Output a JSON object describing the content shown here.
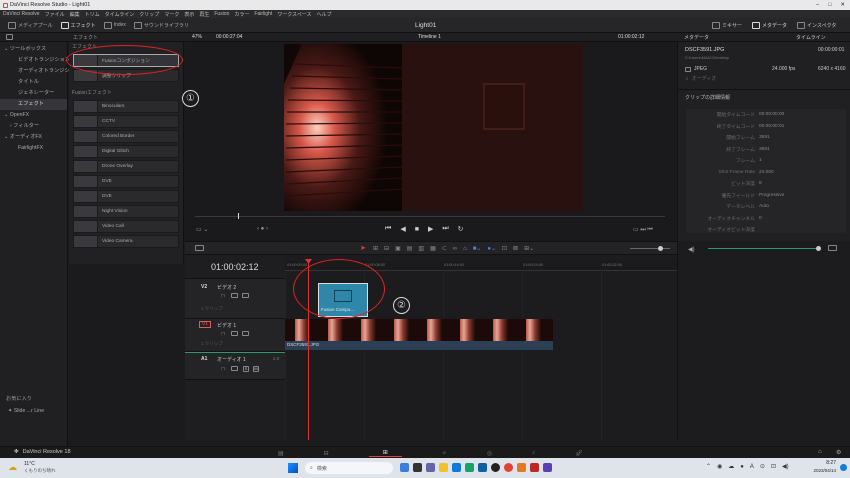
{
  "window": {
    "title": "DaVinci Resolve Studio - Light01"
  },
  "menu": [
    "DaVinci Resolve",
    "ファイル",
    "編集",
    "トリム",
    "タイムライン",
    "クリップ",
    "マーク",
    "表示",
    "再生",
    "Fusion",
    "カラー",
    "Fairlight",
    "ワークスペース",
    "ヘルプ"
  ],
  "toolbar": {
    "media_pool": "メディアプール",
    "effects": "エフェクト",
    "index": "Index",
    "sound_library": "サウンドライブラリ",
    "project_title": "Light01",
    "mixer": "ミキサー",
    "metadata": "メタデータ",
    "inspector": "インスペクタ"
  },
  "subbar": {
    "effects_header": "エフェクト",
    "zoom": "47%",
    "source_tc": "00:00:27:04",
    "timeline_name": "Timeline 1",
    "record_tc": "01:00:02:12",
    "metadata_header": "メタデータ",
    "timeline_header": "タイムライン"
  },
  "tree": {
    "items": [
      "ツールボックス",
      "ビデオトランジション",
      "オーディオトランジション",
      "タイトル",
      "ジェネレーター",
      "エフェクト",
      "OpenFX",
      "フィルター",
      "オーディオFX",
      "FairlightFX"
    ],
    "favorites_header": "お気に入り",
    "favorite_item": "Slide ...r Line"
  },
  "effects": {
    "section1": "エフェクト",
    "items1": [
      "Fusionコンポジション",
      "調整クリップ"
    ],
    "section2": "Fusionエフェクト",
    "items2": [
      "Binoculars",
      "CCTV",
      "Colored Border",
      "Digital Glitch",
      "Drone Overlay",
      "DVE",
      "DVE",
      "Night Vision",
      "Video Call",
      "Video Camera"
    ]
  },
  "metadata": {
    "clip_name": "DSCF3591.JPG",
    "clip_tc": "00:00:00:01",
    "clip_path": "C:\\Users\\MAKO\\Desktop",
    "format": "JPEG",
    "fps": "24.000 fps",
    "resolution": "6240 x 4160",
    "audio": "オーディオ",
    "details_header": "クリップの詳細情報",
    "rows": [
      {
        "k": "開始タイムコード",
        "v": "00:00:00:00"
      },
      {
        "k": "終了タイムコード",
        "v": "00:00:00:01"
      },
      {
        "k": "開始フレーム",
        "v": "3591"
      },
      {
        "k": "終了フレーム",
        "v": "3591"
      },
      {
        "k": "フレーム",
        "v": "1"
      },
      {
        "k": "Shot Frame Rate",
        "v": "24.000"
      },
      {
        "k": "ビット深度",
        "v": "8"
      },
      {
        "k": "優先フィールド",
        "v": "Progressive"
      },
      {
        "k": "データレベル",
        "v": "Auto"
      },
      {
        "k": "オーディオチャンネル",
        "v": "0"
      },
      {
        "k": "オーディオビット深度",
        "v": ""
      }
    ]
  },
  "timeline": {
    "timecode": "01:00:02:12",
    "ruler": [
      "01:00:00:00",
      "01:00:08:00",
      "01:00:16:00",
      "01:00:24:00",
      "01:00:32:00",
      "01:00:40:00",
      "01:00:48:00",
      "01:00:56:00"
    ],
    "v2_id": "V2",
    "v2_name": "ビデオ 2",
    "v2_clips": "1 クリップ",
    "v1_id": "V1",
    "v1_name": "ビデオ 1",
    "v1_clips": "1 クリップ",
    "a1_id": "A1",
    "a1_name": "オーディオ 1",
    "a1_level": "2.0",
    "fusion_clip": "Fusion Compo...",
    "image_clip": "DSCF3591.JPG"
  },
  "annotations": {
    "one": "①",
    "two": "②"
  },
  "pagebar": {
    "app": "DaVinci Resolve 18"
  },
  "taskbar": {
    "weather_temp": "11°C",
    "weather_desc": "くもりのち晴れ",
    "search": "検索",
    "time": "8:27",
    "date": "2023/04/14"
  },
  "colors": {
    "accent": "#2f7fbf",
    "annotation": "#e02020",
    "fusion_clip": "#2e86a8",
    "playhead": "#e03030"
  }
}
